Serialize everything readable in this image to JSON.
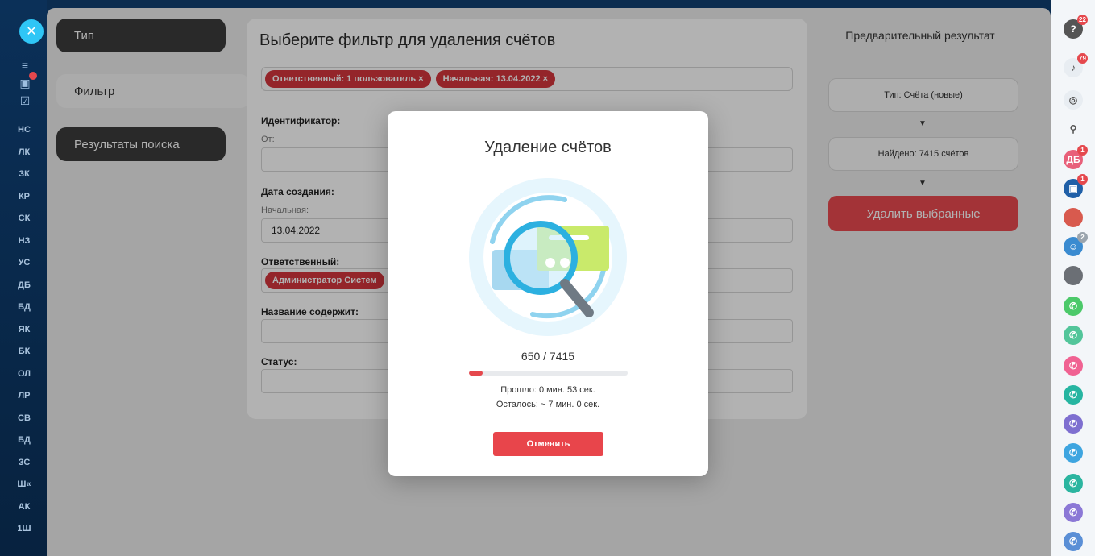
{
  "left_nav": {
    "items": [
      "НС",
      "ЛК",
      "ЗК",
      "КР",
      "СК",
      "НЗ",
      "УС",
      "ДБ",
      "БД",
      "ЯК",
      "БК",
      "ОЛ",
      "ЛР",
      "СВ",
      "БД",
      "ЗС",
      "Ш«",
      "АК",
      "1Ш"
    ]
  },
  "steps": {
    "type": "Тип",
    "filter": "Фильтр",
    "results": "Результаты поиска"
  },
  "filter": {
    "title": "Выберите фильтр для удаления счётов",
    "tags": [
      "Ответственный: 1 пользователь ×",
      "Начальная: 13.04.2022 ×"
    ],
    "id_label": "Идентификатор:",
    "id_from": "От:",
    "created_label": "Дата создания:",
    "created_start_label": "Начальная:",
    "created_start_value": "13.04.2022",
    "responsible_label": "Ответственный:",
    "responsible_tag": "Администратор Систем",
    "name_contains_label": "Название содержит:",
    "status_label": "Статус:"
  },
  "preview": {
    "title": "Предварительный результат",
    "type": "Тип: Счёта (новые)",
    "found": "Найдено: 7415 счётов",
    "arrow": "▼",
    "delete_button": "Удалить выбранные"
  },
  "modal": {
    "title": "Удаление счётов",
    "count": "650 / 7415",
    "progress_fraction": 0.0877,
    "elapsed": "Прошло: 0 мин. 53 сек.",
    "remaining": "Осталось: ~ 7 мин. 0 сек.",
    "cancel": "Отменить"
  },
  "right_bar": {
    "help_badge": "22",
    "notif_badge": "79",
    "avatar_db": "ДБ",
    "avatar_db_badge": "1",
    "group_badge": "1",
    "users_badge": "2"
  },
  "colors": {
    "accent_red": "#e5484d",
    "nav_bg": "#0b3058",
    "tag_red": "#d4353d"
  }
}
